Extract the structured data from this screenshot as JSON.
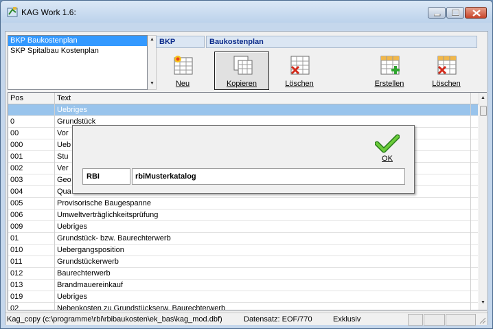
{
  "window": {
    "title": "KAG Work 1.6:"
  },
  "catalogs": [
    {
      "label": "BKP Baukostenplan",
      "selected": true
    },
    {
      "label": "SKP Spitalbau Kostenplan",
      "selected": false
    }
  ],
  "header": {
    "code": "BKP",
    "name": "Baukostenplan"
  },
  "toolbar": {
    "new_label": "Neu",
    "copy_label": "Kopieren",
    "delete_label": "Löschen",
    "create_label": "Erstellen",
    "delete2_label": "Löschen"
  },
  "grid": {
    "columns": {
      "pos": "Pos",
      "text": "Text"
    },
    "rows": [
      {
        "pos": "",
        "text": "Uebriges"
      },
      {
        "pos": "0",
        "text": "Grundstück"
      },
      {
        "pos": "00",
        "text": "Vor"
      },
      {
        "pos": "000",
        "text": "Ueb"
      },
      {
        "pos": "001",
        "text": "Stu"
      },
      {
        "pos": "002",
        "text": "Ver"
      },
      {
        "pos": "003",
        "text": "Geo"
      },
      {
        "pos": "004",
        "text": "Qua"
      },
      {
        "pos": "005",
        "text": "Provisorische Baugespanne"
      },
      {
        "pos": "006",
        "text": "Umweltverträglichkeitsprüfung"
      },
      {
        "pos": "009",
        "text": "Uebriges"
      },
      {
        "pos": "01",
        "text": "Grundstück- bzw. Baurechterwerb"
      },
      {
        "pos": "010",
        "text": "Uebergangsposition"
      },
      {
        "pos": "011",
        "text": "Grundstückerwerb"
      },
      {
        "pos": "012",
        "text": "Baurechterwerb"
      },
      {
        "pos": "013",
        "text": "Brandmauereinkauf"
      },
      {
        "pos": "019",
        "text": "Uebriges"
      },
      {
        "pos": "02",
        "text": "Nebenkosten zu Grundstückserw. Baurechterwerb"
      }
    ]
  },
  "statusbar": {
    "file": "Kag_copy (c:\\programme\\rbi\\rbibaukosten\\ek_bas\\kag_mod.dbf)",
    "record": "Datensatz: EOF/770",
    "mode": "Exklusiv"
  },
  "dialog": {
    "ok_label": "OK",
    "field_label": "RBI",
    "field_value": "rbiMusterkatalog"
  },
  "colors": {
    "selection": "#3399ff",
    "grid_selection": "#99c4ec",
    "header_text": "#0a2a8a"
  }
}
